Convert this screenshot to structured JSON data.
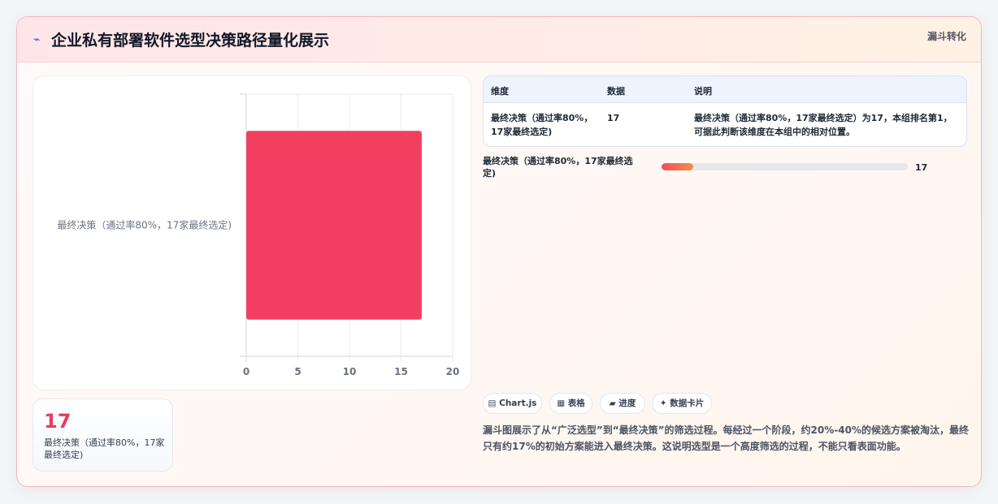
{
  "header": {
    "icon": "pulse-icon",
    "title": "企业私有部署软件选型决策路径量化展示",
    "tag": "漏斗转化"
  },
  "chart_data": {
    "type": "bar",
    "orientation": "horizontal",
    "categories": [
      "最终决策（通过率80%，17家最终选定)"
    ],
    "values": [
      17
    ],
    "xlim": [
      0,
      20
    ],
    "xticks": [
      "0",
      "5",
      "10",
      "15",
      "20"
    ],
    "grid": true,
    "legend": "none",
    "bar_color": "#f23f5f"
  },
  "stat": {
    "value": "17",
    "label": "最终决策（通过率80%，17家最终选定)"
  },
  "table": {
    "headers": [
      "维度",
      "数据",
      "说明"
    ],
    "rows": [
      [
        "最终决策（通过率80%，17家最终选定)",
        "17",
        "最终决策（通过率80%，17家最终选定）为17，本组排名第1，可据此判断该维度在本组中的相对位置。"
      ]
    ]
  },
  "progress": {
    "label": "最终决策（通过率80%，17家最终选定)",
    "value": "17",
    "fraction": 0.13
  },
  "chips": [
    {
      "icon": "chart-icon",
      "label": "▤ Chart.js"
    },
    {
      "icon": "table-icon",
      "label": "▦ 表格"
    },
    {
      "icon": "progress-icon",
      "label": "▰ 进度"
    },
    {
      "icon": "sparkle-icon",
      "label": "✦ 数据卡片"
    }
  ],
  "description": "漏斗图展示了从“广泛选型”到“最终决策”的筛选过程。每经过一个阶段，约20%-40%的候选方案被淘汰，最终只有约17%的初始方案能进入最终决策。这说明选型是一个高度筛选的过程，不能只看表面功能。"
}
